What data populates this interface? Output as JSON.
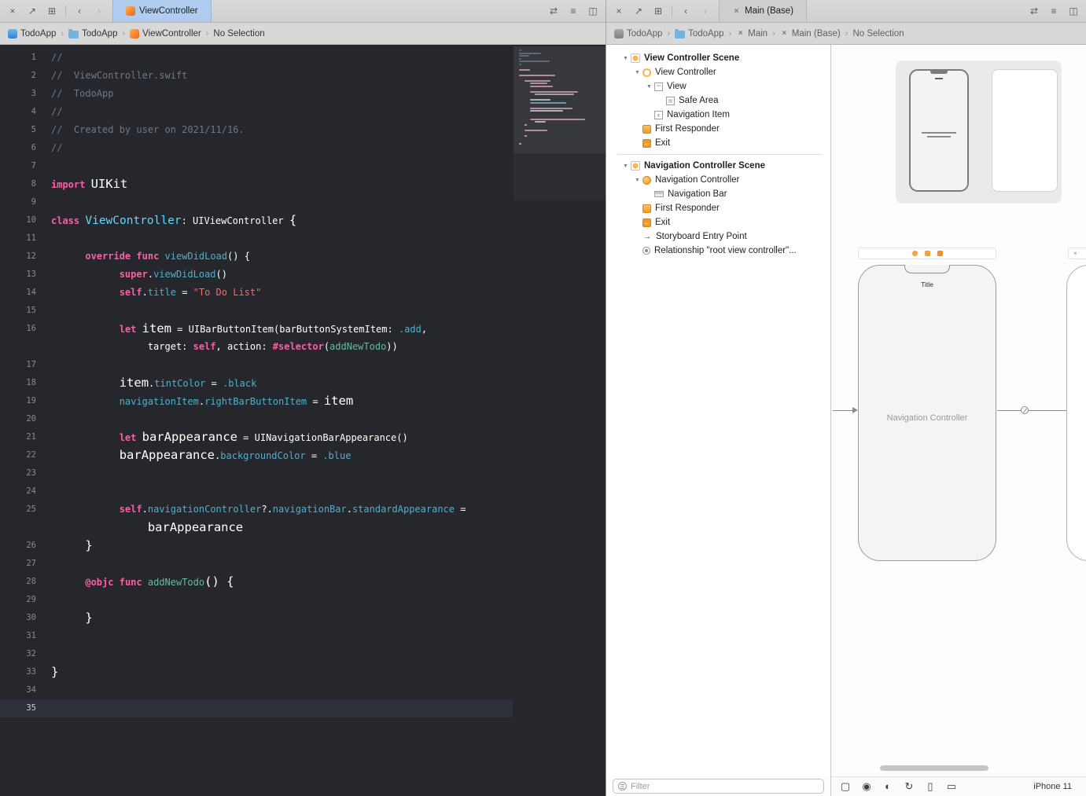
{
  "colors": {
    "editor_background": "#26272c",
    "active_tab": "#b0cdf0",
    "syntax_keyword": "#FC5FA3",
    "syntax_string": "#FC6A5D",
    "syntax_comment": "#6C7986",
    "syntax_member": "#4EB0CC",
    "syntax_project_function": "#67B7A4",
    "syntax_type": "#5DD8FF",
    "accent_orange": "#f2a33c"
  },
  "left_editor": {
    "tabbar": {
      "tab_label": "ViewController"
    },
    "breadcrumb": {
      "items": [
        {
          "label": "TodoApp",
          "icon": "app-icon"
        },
        {
          "label": "TodoApp",
          "icon": "folder-icon"
        },
        {
          "label": "ViewController",
          "icon": "swift-file-icon"
        },
        {
          "label": "No Selection",
          "icon": null
        }
      ]
    },
    "code_lines": [
      {
        "n": "1",
        "s": [
          [
            "c",
            "//"
          ]
        ]
      },
      {
        "n": "2",
        "s": [
          [
            "c",
            "//  ViewController.swift"
          ]
        ]
      },
      {
        "n": "3",
        "s": [
          [
            "c",
            "//  TodoApp"
          ]
        ]
      },
      {
        "n": "4",
        "s": [
          [
            "c",
            "//"
          ]
        ]
      },
      {
        "n": "5",
        "s": [
          [
            "c",
            "//  Created by user on 2021/11/16."
          ]
        ]
      },
      {
        "n": "6",
        "s": [
          [
            "c",
            "//"
          ]
        ]
      },
      {
        "n": "7",
        "s": []
      },
      {
        "n": "8",
        "s": [
          [
            "k",
            "import"
          ],
          [
            "p",
            " "
          ],
          [
            "P",
            "UIKit"
          ]
        ]
      },
      {
        "n": "9",
        "s": []
      },
      {
        "n": "10",
        "s": [
          [
            "k",
            "class"
          ],
          [
            "p",
            " "
          ],
          [
            "tb",
            "ViewController"
          ],
          [
            "p",
            ": UIViewController "
          ],
          [
            "P",
            "{"
          ]
        ]
      },
      {
        "n": "11",
        "s": []
      },
      {
        "n": "12",
        "s": [
          [
            "p",
            "      "
          ],
          [
            "k",
            "override"
          ],
          [
            "p",
            " "
          ],
          [
            "k",
            "func"
          ],
          [
            "p",
            " "
          ],
          [
            "m",
            "viewDidLoad"
          ],
          [
            "p",
            "() {"
          ]
        ]
      },
      {
        "n": "13",
        "s": [
          [
            "p",
            "            "
          ],
          [
            "k",
            "super"
          ],
          [
            "p",
            "."
          ],
          [
            "m",
            "viewDidLoad"
          ],
          [
            "p",
            "()"
          ]
        ]
      },
      {
        "n": "14",
        "s": [
          [
            "p",
            "            "
          ],
          [
            "k",
            "self"
          ],
          [
            "p",
            "."
          ],
          [
            "m",
            "title"
          ],
          [
            "p",
            " = "
          ],
          [
            "s",
            "\"To Do List\""
          ]
        ]
      },
      {
        "n": "15",
        "s": []
      },
      {
        "n": "16",
        "s": [
          [
            "p",
            "            "
          ],
          [
            "k",
            "let"
          ],
          [
            "p",
            " "
          ],
          [
            "P",
            "item"
          ],
          [
            "p",
            " = UIBarButtonItem(barButtonSystemItem: "
          ],
          [
            "m",
            ".add"
          ],
          [
            "p",
            ","
          ]
        ]
      },
      {
        "n": "",
        "s": [
          [
            "p",
            "                 target: "
          ],
          [
            "k",
            "self"
          ],
          [
            "p",
            ", action: "
          ],
          [
            "k",
            "#selector"
          ],
          [
            "p",
            "("
          ],
          [
            "f",
            "addNewTodo"
          ],
          [
            "p",
            "))"
          ]
        ]
      },
      {
        "n": "17",
        "s": []
      },
      {
        "n": "18",
        "s": [
          [
            "p",
            "            "
          ],
          [
            "P",
            "item"
          ],
          [
            "p",
            "."
          ],
          [
            "m",
            "tintColor"
          ],
          [
            "p",
            " = "
          ],
          [
            "m",
            ".black"
          ]
        ]
      },
      {
        "n": "19",
        "s": [
          [
            "p",
            "            "
          ],
          [
            "m",
            "navigationItem"
          ],
          [
            "p",
            "."
          ],
          [
            "m",
            "rightBarButtonItem"
          ],
          [
            "p",
            " = "
          ],
          [
            "P",
            "item"
          ]
        ]
      },
      {
        "n": "20",
        "s": []
      },
      {
        "n": "21",
        "s": [
          [
            "p",
            "            "
          ],
          [
            "k",
            "let"
          ],
          [
            "p",
            " "
          ],
          [
            "P",
            "barAppearance"
          ],
          [
            "p",
            " = UINavigationBarAppearance()"
          ]
        ]
      },
      {
        "n": "22",
        "s": [
          [
            "p",
            "            "
          ],
          [
            "P",
            "barAppearance"
          ],
          [
            "p",
            "."
          ],
          [
            "m",
            "backgroundColor"
          ],
          [
            "p",
            " = "
          ],
          [
            "m",
            ".blue"
          ]
        ]
      },
      {
        "n": "23",
        "s": []
      },
      {
        "n": "24",
        "s": []
      },
      {
        "n": "25",
        "s": [
          [
            "p",
            "            "
          ],
          [
            "k",
            "self"
          ],
          [
            "p",
            "."
          ],
          [
            "m",
            "navigationController"
          ],
          [
            "p",
            "?."
          ],
          [
            "m",
            "navigationBar"
          ],
          [
            "p",
            "."
          ],
          [
            "m",
            "standardAppearance"
          ],
          [
            "p",
            " ="
          ]
        ]
      },
      {
        "n": "",
        "s": [
          [
            "p",
            "                 "
          ],
          [
            "P",
            "barAppearance"
          ]
        ]
      },
      {
        "n": "26",
        "s": [
          [
            "p",
            "      "
          ],
          [
            "P",
            "}"
          ]
        ]
      },
      {
        "n": "27",
        "s": []
      },
      {
        "n": "28",
        "s": [
          [
            "p",
            "      "
          ],
          [
            "k",
            "@objc"
          ],
          [
            "p",
            " "
          ],
          [
            "k",
            "func"
          ],
          [
            "p",
            " "
          ],
          [
            "f",
            "addNewTodo"
          ],
          [
            "P",
            "() {"
          ]
        ]
      },
      {
        "n": "29",
        "s": []
      },
      {
        "n": "30",
        "s": [
          [
            "p",
            "      "
          ],
          [
            "P",
            "}"
          ]
        ]
      },
      {
        "n": "31",
        "s": []
      },
      {
        "n": "32",
        "s": []
      },
      {
        "n": "33",
        "s": [
          [
            "P",
            "}"
          ]
        ]
      },
      {
        "n": "34",
        "s": []
      },
      {
        "n": "35",
        "s": [],
        "cur": true
      }
    ]
  },
  "right_editor": {
    "tabbar": {
      "tab_label": "Main (Base)"
    },
    "breadcrumb": {
      "items": [
        {
          "label": "TodoApp",
          "icon": "app-icon"
        },
        {
          "label": "TodoApp",
          "icon": "folder-icon"
        },
        {
          "label": "Main",
          "icon": "storyboard-icon"
        },
        {
          "label": "Main (Base)",
          "icon": "storyboard-icon"
        },
        {
          "label": "No Selection",
          "icon": null
        }
      ]
    },
    "outline": {
      "items": [
        {
          "label": "View Controller Scene",
          "level": 0,
          "disc": true,
          "bold": true,
          "icon": "vc-scene"
        },
        {
          "label": "View Controller",
          "level": 1,
          "disc": true,
          "icon": "view-controller"
        },
        {
          "label": "View",
          "level": 2,
          "disc": true,
          "icon": "view"
        },
        {
          "label": "Safe Area",
          "level": 3,
          "icon": "safe-area"
        },
        {
          "label": "Navigation Item",
          "level": 2,
          "icon": "navigation-item"
        },
        {
          "label": "First Responder",
          "level": 1,
          "icon": "first-responder"
        },
        {
          "label": "Exit",
          "level": 1,
          "icon": "exit"
        },
        {
          "divider": true
        },
        {
          "label": "Navigation Controller Scene",
          "level": 0,
          "disc": true,
          "bold": true,
          "icon": "nc-scene"
        },
        {
          "label": "Navigation Controller",
          "level": 1,
          "disc": true,
          "icon": "navigation-controller"
        },
        {
          "label": "Navigation Bar",
          "level": 2,
          "icon": "navigation-bar"
        },
        {
          "label": "First Responder",
          "level": 1,
          "icon": "first-responder"
        },
        {
          "label": "Exit",
          "level": 1,
          "icon": "exit"
        },
        {
          "label": "Storyboard Entry Point",
          "level": 1,
          "icon": "entry-point"
        },
        {
          "label": "Relationship \"root view controller\"...",
          "level": 1,
          "icon": "relationship"
        }
      ]
    },
    "filter": {
      "placeholder": "Filter"
    },
    "canvas": {
      "scene_nav_title": "Title",
      "scene_label": "Navigation Controller",
      "footer_device_label": "iPhone 11",
      "footer_icons": [
        "frame-icon",
        "traits-icon",
        "appearance-icon",
        "rotate-icon",
        "device-phone-icon",
        "device-tablet-icon"
      ]
    }
  }
}
